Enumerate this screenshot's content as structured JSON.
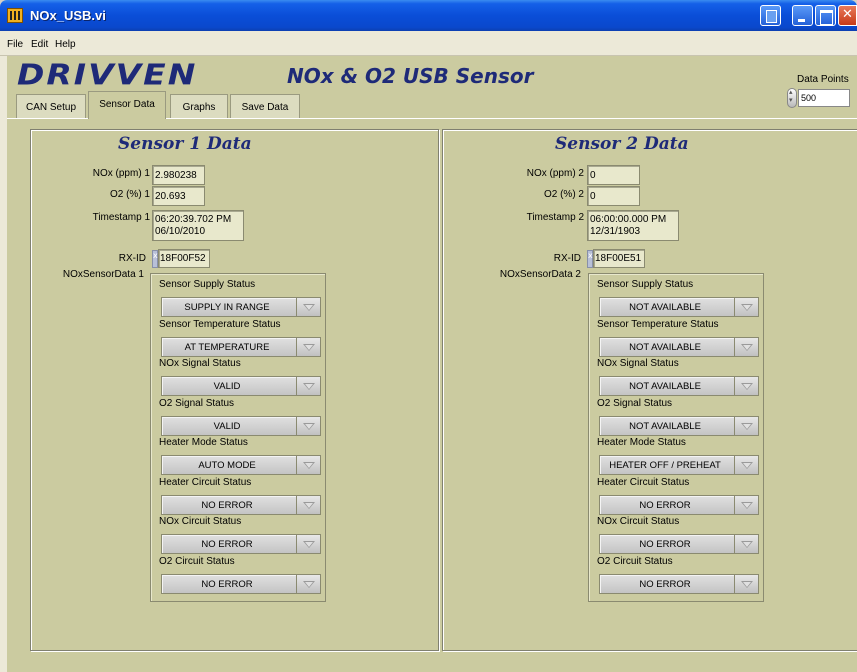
{
  "window": {
    "title": "NOx_USB.vi"
  },
  "menu": [
    "File",
    "Edit",
    "Help"
  ],
  "header": {
    "logo": "DRIVVEN",
    "title": "NOx & O2 USB Sensor",
    "data_points_label": "Data Points",
    "data_points_value": "500"
  },
  "tabs": [
    "CAN Setup",
    "Sensor Data",
    "Graphs",
    "Save Data"
  ],
  "active_tab": "Sensor Data",
  "sensor1": {
    "heading": "Sensor 1 Data",
    "nox_label": "NOx (ppm) 1",
    "nox_value": "2.980238",
    "o2_label": "O2 (%) 1",
    "o2_value": "20.693",
    "timestamp_label": "Timestamp 1",
    "timestamp_time": "06:20:39.702 PM",
    "timestamp_date": "06/10/2010",
    "rxid_label": "RX-ID",
    "rxid_radix": "x",
    "rxid_value": "18F00F52",
    "cluster_label": "NOxSensorData 1",
    "statuses": [
      {
        "label": "Sensor Supply Status",
        "value": "SUPPLY IN RANGE"
      },
      {
        "label": "Sensor Temperature Status",
        "value": "AT TEMPERATURE"
      },
      {
        "label": "NOx Signal Status",
        "value": "VALID"
      },
      {
        "label": "O2 Signal Status",
        "value": "VALID"
      },
      {
        "label": "Heater Mode Status",
        "value": "AUTO MODE"
      },
      {
        "label": "Heater Circuit Status",
        "value": "NO ERROR"
      },
      {
        "label": "NOx Circuit Status",
        "value": "NO ERROR"
      },
      {
        "label": "O2 Circuit Status",
        "value": "NO ERROR"
      }
    ]
  },
  "sensor2": {
    "heading": "Sensor 2 Data",
    "nox_label": "NOx (ppm) 2",
    "nox_value": "0",
    "o2_label": "O2 (%) 2",
    "o2_value": "0",
    "timestamp_label": "Timestamp 2",
    "timestamp_time": "06:00:00.000 PM",
    "timestamp_date": "12/31/1903",
    "rxid_label": "RX-ID",
    "rxid_radix": "x",
    "rxid_value": "18F00E51",
    "cluster_label": "NOxSensorData 2",
    "statuses": [
      {
        "label": "Sensor Supply Status",
        "value": "NOT AVAILABLE"
      },
      {
        "label": "Sensor Temperature Status",
        "value": "NOT AVAILABLE"
      },
      {
        "label": "NOx Signal Status",
        "value": "NOT AVAILABLE"
      },
      {
        "label": "O2 Signal Status",
        "value": "NOT AVAILABLE"
      },
      {
        "label": "Heater Mode Status",
        "value": "HEATER OFF / PREHEAT"
      },
      {
        "label": "Heater Circuit Status",
        "value": "NO ERROR"
      },
      {
        "label": "NOx Circuit Status",
        "value": "NO ERROR"
      },
      {
        "label": "O2 Circuit Status",
        "value": "NO ERROR"
      }
    ]
  }
}
